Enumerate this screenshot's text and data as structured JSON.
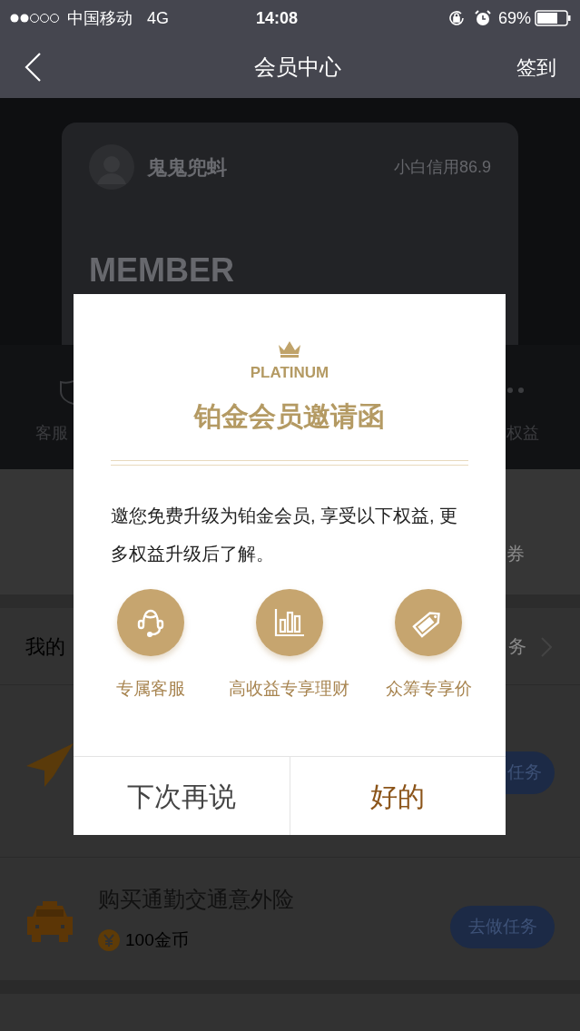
{
  "status_bar": {
    "carrier": "中国移动",
    "network": "4G",
    "time": "14:08",
    "battery": "69%"
  },
  "nav": {
    "title": "会员中心",
    "action": "签到"
  },
  "member_card": {
    "name": "鬼鬼兜蚪",
    "credit": "小白信用86.9",
    "tier": "MEMBER"
  },
  "benefit_strip": {
    "left_label": "客服",
    "right_label": "权益"
  },
  "coupon_section": {
    "right_text": "券"
  },
  "my_row": {
    "title": "我的",
    "link": "务"
  },
  "tasks": [
    {
      "kind": "plane",
      "button": "任务"
    },
    {
      "kind": "taxi",
      "title": "购买通勤交通意外险",
      "reward": "100金币",
      "button": "去做任务"
    }
  ],
  "dialog": {
    "badge": "PLATINUM",
    "title": "铂金会员邀请函",
    "message": "邀您免费升级为铂金会员, 享受以下权益, 更多权益升级后了解。",
    "benefits": [
      {
        "kind": "headset",
        "label": "专属客服"
      },
      {
        "kind": "chart",
        "label": "高收益专享理财"
      },
      {
        "kind": "vip",
        "label": "众筹专享价"
      }
    ],
    "buttons": [
      {
        "label": "下次再说",
        "primary": false
      },
      {
        "label": "好的",
        "primary": true
      }
    ]
  }
}
